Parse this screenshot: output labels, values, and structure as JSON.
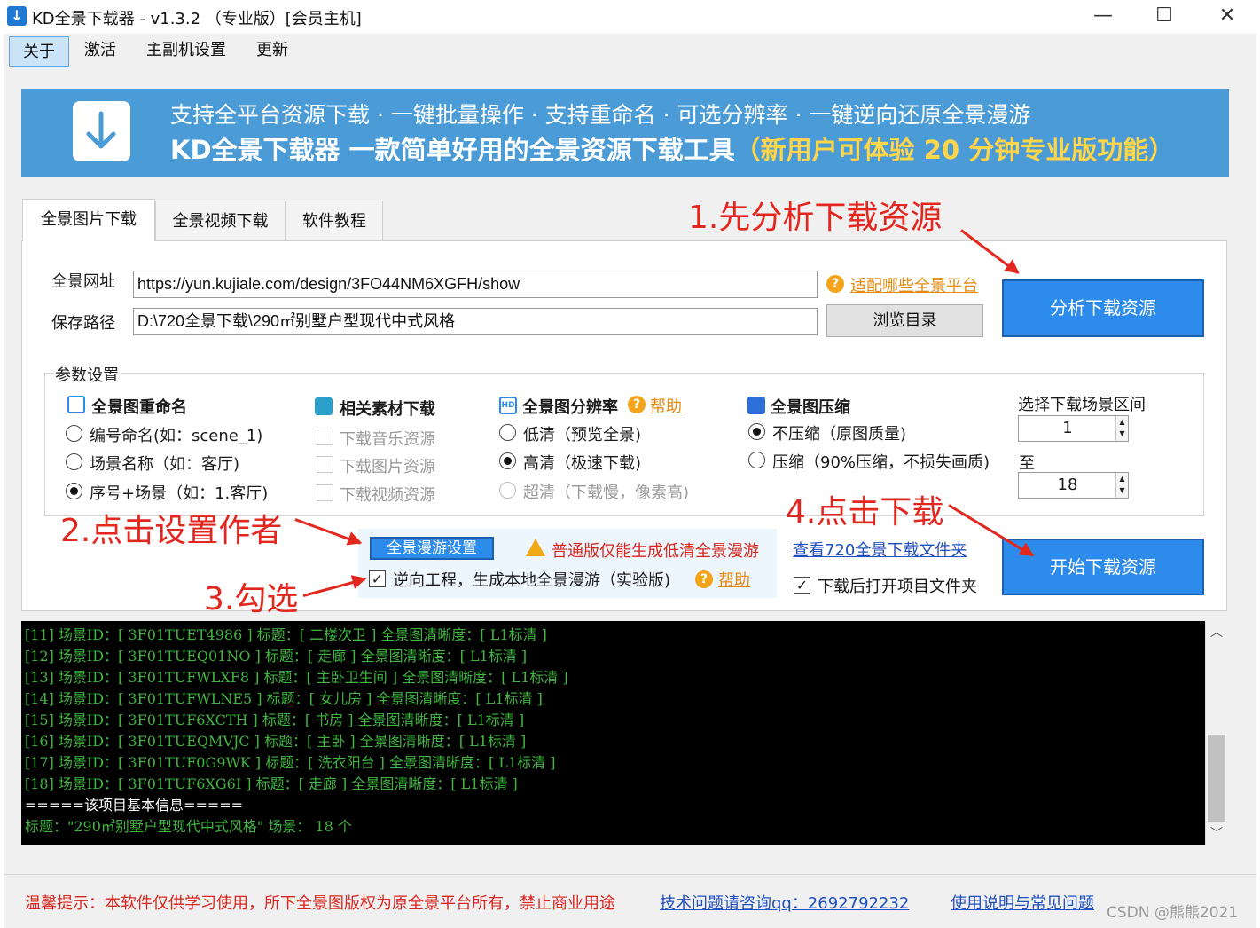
{
  "window": {
    "title": "KD全景下载器 - v1.3.2 （专业版）[会员主机]",
    "app_icon": "download-arrow-icon",
    "minimize": "—",
    "maximize": "☐",
    "close": "✕"
  },
  "menu": {
    "items": [
      "关于",
      "激活",
      "主副机设置",
      "更新"
    ]
  },
  "banner": {
    "line1": "支持全平台资源下载 · 一键批量操作 · 支持重命名 · 可选分辨率 · 一键逆向还原全景漫游",
    "line2_main": "KD全景下载器 一款简单好用的全景资源下载工具",
    "line2_highlight": "（新用户可体验 20 分钟专业版功能）",
    "icon": "download-arrow-icon",
    "bg_color": "#4a9bd6"
  },
  "tabs": [
    "全景图片下载",
    "全景视频下载",
    "软件教程"
  ],
  "form": {
    "url_label": "全景网址",
    "url_value": "https://yun.kujiale.com/design/3FO44NM6XGFH/show",
    "platforms_link": "适配哪些全景平台",
    "path_label": "保存路径",
    "path_value": "D:\\720全景下载\\290㎡别墅户型现代中式风格",
    "browse_button": "浏览目录",
    "analyze_button": "分析下载资源"
  },
  "params": {
    "title": "参数设置",
    "rename": {
      "title": "全景图重命名",
      "options": [
        "编号命名(如：scene_1)",
        "场景名称（如：客厅)",
        "序号+场景（如：1.客厅)"
      ],
      "selected": 2
    },
    "materials": {
      "title": "相关素材下载",
      "options": [
        "下载音乐资源",
        "下载图片资源",
        "下载视频资源"
      ]
    },
    "resolution": {
      "title": "全景图分辨率",
      "help": "帮助",
      "options": [
        "低清（预览全景)",
        "高清（极速下载)",
        "超清（下载慢，像素高)"
      ],
      "selected": 1
    },
    "compression": {
      "title": "全景图压缩",
      "options": [
        "不压缩（原图质量)",
        "压缩（90%压缩，不损失画质)"
      ],
      "selected": 0
    },
    "range": {
      "title": "选择下载场景区间",
      "from": "1",
      "to_label": "至",
      "to": "18"
    }
  },
  "tour": {
    "button": "全景漫游设置",
    "warning": "普通版仅能生成低清全景漫游",
    "reverse_checkbox": "逆向工程，生成本地全景漫游（实验版)",
    "reverse_checked": true,
    "help": "帮助"
  },
  "actions": {
    "view_folder_link": "查看720全景下载文件夹",
    "open_after": "下载后打开项目文件夹",
    "open_after_checked": true,
    "start_button": "开始下载资源"
  },
  "annotations": {
    "step1": "1.先分析下载资源",
    "step2": "2.点击设置作者",
    "step3": "3.勾选",
    "step4": "4.点击下载"
  },
  "console": {
    "lines": [
      "[11] 场景ID：[ 3F01TUET4986 ] 标题：[ 二楼次卫 ] 全景图清晰度：[ L1标清 ]",
      "[12] 场景ID：[ 3F01TUEQ01NO ] 标题：[ 走廊 ] 全景图清晰度：[ L1标清 ]",
      "[13] 场景ID：[ 3F01TUFWLXF8 ] 标题：[ 主卧卫生间 ] 全景图清晰度：[ L1标清 ]",
      "[14] 场景ID：[ 3F01TUFWLNE5 ] 标题：[ 女儿房 ] 全景图清晰度：[ L1标清 ]",
      "[15] 场景ID：[ 3F01TUF6XCTH ] 标题：[ 书房 ] 全景图清晰度：[ L1标清 ]",
      "[16] 场景ID：[ 3F01TUEQMVJC ] 标题：[ 主卧 ] 全景图清晰度：[ L1标清 ]",
      "[17] 场景ID：[ 3F01TUF0G9WK ] 标题：[ 洗衣阳台 ] 全景图清晰度：[ L1标清 ]",
      "[18] 场景ID：[ 3F01TUF6XG6I ] 标题：[ 走廊 ] 全景图清晰度：[ L1标清 ]",
      "=====该项目基本信息=====",
      "标题：\"290㎡别墅户型现代中式风格\"  场景： 18 个"
    ]
  },
  "footer": {
    "notice": "温馨提示：本软件仅供学习使用，所下全景图版权为原全景平台所有，禁止商业用途",
    "qq_link": "技术问题请咨询qq：2692792232",
    "faq_link": "使用说明与常见问题",
    "watermark": "CSDN @熊熊2021"
  }
}
